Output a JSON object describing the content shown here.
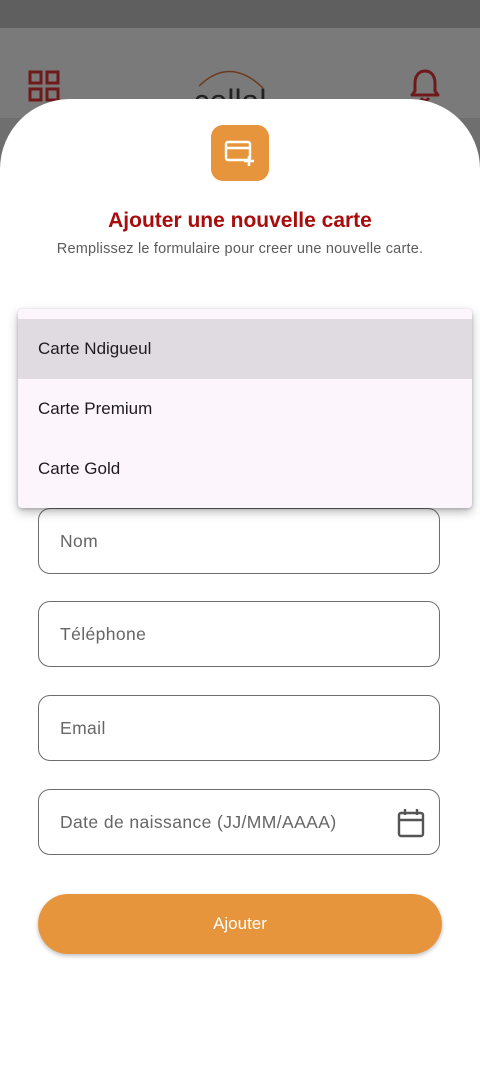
{
  "header": {
    "logo_text": "cellal",
    "grid_icon": "grid-icon",
    "bell_icon": "bell-icon",
    "brand_color": "#a80c0c"
  },
  "sheet": {
    "badge_icon": "add-card-icon",
    "title": "Ajouter une nouvelle carte",
    "subtitle": "Remplissez le formulaire pour creer une nouvelle carte."
  },
  "card_type_menu": {
    "selected_index": 0,
    "options": [
      "Carte Ndigueul",
      "Carte Premium",
      "Carte Gold"
    ]
  },
  "form": {
    "name_placeholder": "Nom",
    "phone_placeholder": "Téléphone",
    "email_placeholder": "Email",
    "birthdate_placeholder": "Date de naissance (JJ/MM/AAAA)",
    "calendar_icon": "calendar-icon",
    "submit_label": "Ajouter"
  },
  "colors": {
    "accent": "#e7953c",
    "title": "#a80c0c",
    "menu_bg": "#fdf5fc",
    "menu_selected": "#e0dbe0"
  }
}
